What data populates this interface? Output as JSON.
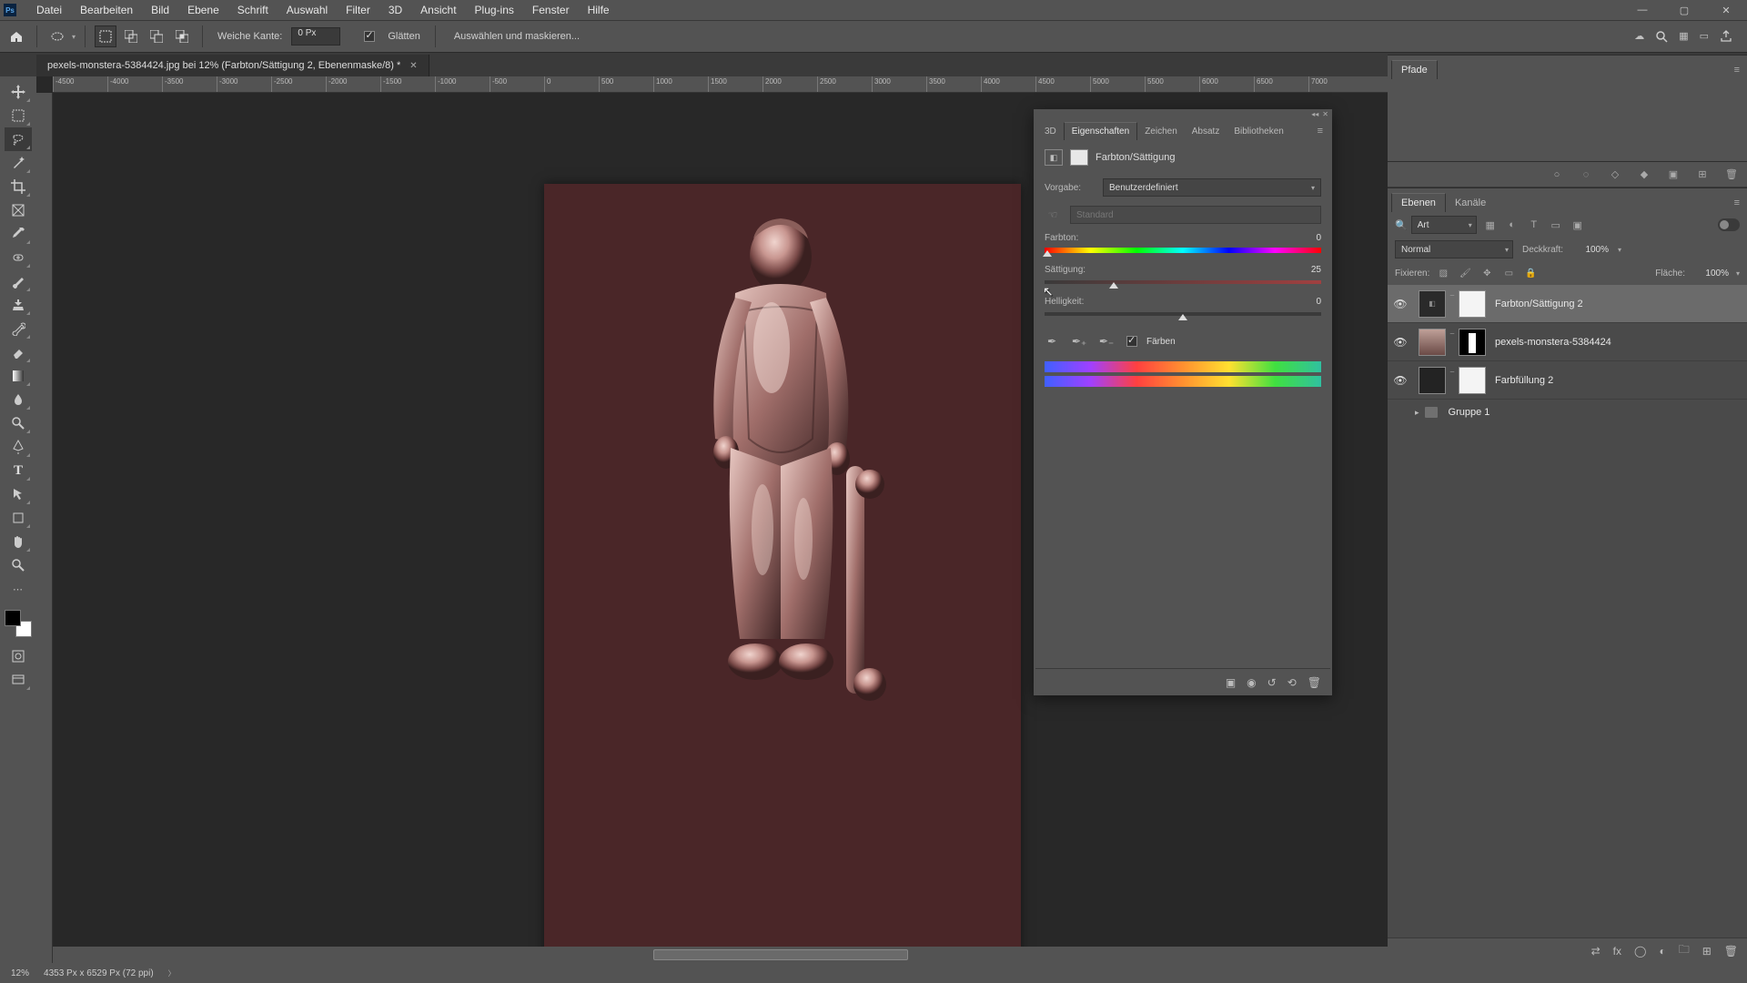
{
  "menubar": {
    "items": [
      "Datei",
      "Bearbeiten",
      "Bild",
      "Ebene",
      "Schrift",
      "Auswahl",
      "Filter",
      "3D",
      "Ansicht",
      "Plug-ins",
      "Fenster",
      "Hilfe"
    ]
  },
  "optbar": {
    "feather_label": "Weiche Kante:",
    "feather_value": "0 Px",
    "antialias_label": "Glätten",
    "mask_button": "Auswählen und maskieren..."
  },
  "document": {
    "tab_title": "pexels-monstera-5384424.jpg bei 12% (Farbton/Sättigung 2, Ebenenmaske/8) *"
  },
  "ruler": {
    "ticks": [
      "-4500",
      "-4000",
      "-3500",
      "-3000",
      "-2500",
      "-2000",
      "-1500",
      "-1000",
      "-500",
      "0",
      "500",
      "1000",
      "1500",
      "2000",
      "2500",
      "3000",
      "3500",
      "4000",
      "4500",
      "5000",
      "5500",
      "6000",
      "6500",
      "7000"
    ]
  },
  "properties": {
    "tabs": [
      "3D",
      "Eigenschaften",
      "Zeichen",
      "Absatz",
      "Bibliotheken"
    ],
    "title": "Farbton/Sättigung",
    "preset_label": "Vorgabe:",
    "preset_value": "Benutzerdefiniert",
    "range_value": "Standard",
    "hue_label": "Farbton:",
    "hue_value": "0",
    "sat_label": "Sättigung:",
    "sat_value": "25",
    "light_label": "Helligkeit:",
    "light_value": "0",
    "colorize_label": "Färben"
  },
  "paths": {
    "tab": "Pfade"
  },
  "layers": {
    "tabs": [
      "Ebenen",
      "Kanäle"
    ],
    "kind_label": "Art",
    "blend_mode": "Normal",
    "opacity_label": "Deckkraft:",
    "opacity_value": "100%",
    "lock_label": "Fixieren:",
    "fill_label": "Fläche:",
    "fill_value": "100%",
    "rows": [
      {
        "name": "Farbton/Sättigung 2"
      },
      {
        "name": "pexels-monstera-5384424"
      },
      {
        "name": "Farbfüllung 2"
      }
    ],
    "group_name": "Gruppe 1"
  },
  "status": {
    "zoom": "12%",
    "doc_info": "4353 Px x 6529 Px (72 ppi)"
  }
}
